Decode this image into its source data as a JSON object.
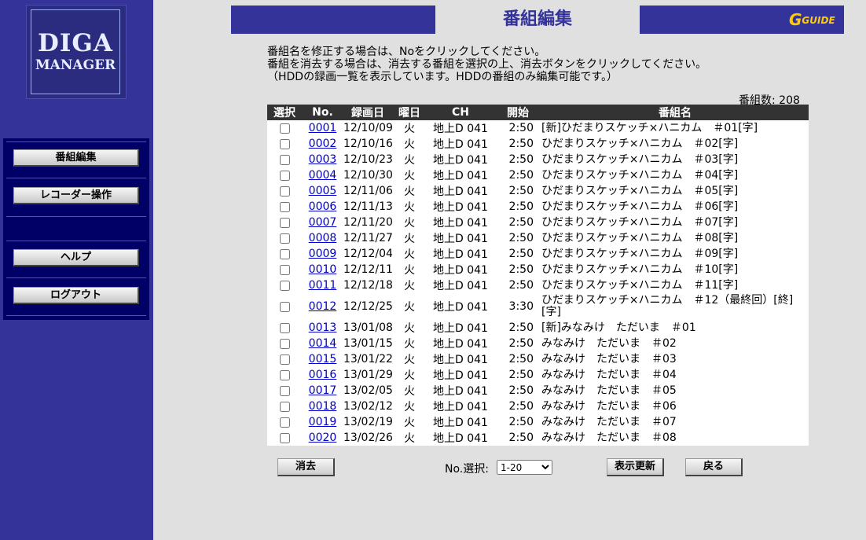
{
  "logo": {
    "line1": "DIGA",
    "line2": "MANAGER"
  },
  "menu": {
    "items": [
      {
        "label": "番組編集"
      },
      {
        "label": "レコーダー操作"
      },
      {
        "label": "ヘルプ"
      },
      {
        "label": "ログアウト"
      }
    ]
  },
  "header": {
    "title": "番組編集",
    "guide_logo": "GUIDE",
    "guide_g": "G"
  },
  "instructions": {
    "line1": "番組名を修正する場合は、Noをクリックしてください。",
    "line2": "番組を消去する場合は、消去する番組を選択の上、消去ボタンをクリックしてください。",
    "line3": "（HDDの録画一覧を表示しています。HDDの番組のみ編集可能です。）"
  },
  "count": {
    "label": "番組数: 208"
  },
  "table": {
    "headers": [
      "選択",
      "No.",
      "録画日",
      "曜日",
      "CH",
      "開始",
      "番組名"
    ],
    "rows": [
      {
        "no": "0001",
        "date": "12/10/09",
        "day": "火",
        "ch": "地上D 041",
        "start": "2:50",
        "title": "[新]ひだまりスケッチ×ハニカム　＃01[字]"
      },
      {
        "no": "0002",
        "date": "12/10/16",
        "day": "火",
        "ch": "地上D 041",
        "start": "2:50",
        "title": "ひだまりスケッチ×ハニカム　＃02[字]"
      },
      {
        "no": "0003",
        "date": "12/10/23",
        "day": "火",
        "ch": "地上D 041",
        "start": "2:50",
        "title": "ひだまりスケッチ×ハニカム　＃03[字]"
      },
      {
        "no": "0004",
        "date": "12/10/30",
        "day": "火",
        "ch": "地上D 041",
        "start": "2:50",
        "title": "ひだまりスケッチ×ハニカム　＃04[字]"
      },
      {
        "no": "0005",
        "date": "12/11/06",
        "day": "火",
        "ch": "地上D 041",
        "start": "2:50",
        "title": "ひだまりスケッチ×ハニカム　＃05[字]"
      },
      {
        "no": "0006",
        "date": "12/11/13",
        "day": "火",
        "ch": "地上D 041",
        "start": "2:50",
        "title": "ひだまりスケッチ×ハニカム　＃06[字]"
      },
      {
        "no": "0007",
        "date": "12/11/20",
        "day": "火",
        "ch": "地上D 041",
        "start": "2:50",
        "title": "ひだまりスケッチ×ハニカム　＃07[字]"
      },
      {
        "no": "0008",
        "date": "12/11/27",
        "day": "火",
        "ch": "地上D 041",
        "start": "2:50",
        "title": "ひだまりスケッチ×ハニカム　＃08[字]"
      },
      {
        "no": "0009",
        "date": "12/12/04",
        "day": "火",
        "ch": "地上D 041",
        "start": "2:50",
        "title": "ひだまりスケッチ×ハニカム　＃09[字]"
      },
      {
        "no": "0010",
        "date": "12/12/11",
        "day": "火",
        "ch": "地上D 041",
        "start": "2:50",
        "title": "ひだまりスケッチ×ハニカム　＃10[字]"
      },
      {
        "no": "0011",
        "date": "12/12/18",
        "day": "火",
        "ch": "地上D 041",
        "start": "2:50",
        "title": "ひだまりスケッチ×ハニカム　＃11[字]"
      },
      {
        "no": "0012",
        "date": "12/12/25",
        "day": "火",
        "ch": "地上D 041",
        "start": "3:30",
        "title": "ひだまりスケッチ×ハニカム　＃12（最終回）[終][字]"
      },
      {
        "no": "0013",
        "date": "13/01/08",
        "day": "火",
        "ch": "地上D 041",
        "start": "2:50",
        "title": "[新]みなみけ　ただいま　＃01"
      },
      {
        "no": "0014",
        "date": "13/01/15",
        "day": "火",
        "ch": "地上D 041",
        "start": "2:50",
        "title": "みなみけ　ただいま　＃02"
      },
      {
        "no": "0015",
        "date": "13/01/22",
        "day": "火",
        "ch": "地上D 041",
        "start": "2:50",
        "title": "みなみけ　ただいま　＃03"
      },
      {
        "no": "0016",
        "date": "13/01/29",
        "day": "火",
        "ch": "地上D 041",
        "start": "2:50",
        "title": "みなみけ　ただいま　＃04"
      },
      {
        "no": "0017",
        "date": "13/02/05",
        "day": "火",
        "ch": "地上D 041",
        "start": "2:50",
        "title": "みなみけ　ただいま　＃05"
      },
      {
        "no": "0018",
        "date": "13/02/12",
        "day": "火",
        "ch": "地上D 041",
        "start": "2:50",
        "title": "みなみけ　ただいま　＃06"
      },
      {
        "no": "0019",
        "date": "13/02/19",
        "day": "火",
        "ch": "地上D 041",
        "start": "2:50",
        "title": "みなみけ　ただいま　＃07"
      },
      {
        "no": "0020",
        "date": "13/02/26",
        "day": "火",
        "ch": "地上D 041",
        "start": "2:50",
        "title": "みなみけ　ただいま　＃08"
      }
    ]
  },
  "footer": {
    "delete_label": "消去",
    "no_select_label": "No.選択:",
    "no_select_value": "1-20",
    "refresh_label": "表示更新",
    "back_label": "戻る"
  },
  "colors": {
    "sidebar": "#333399",
    "menu_panel": "#000066",
    "header_bar": "#333399",
    "table_header": "#333333",
    "link": "#0000cc",
    "guide_logo": "#ffcc00"
  }
}
